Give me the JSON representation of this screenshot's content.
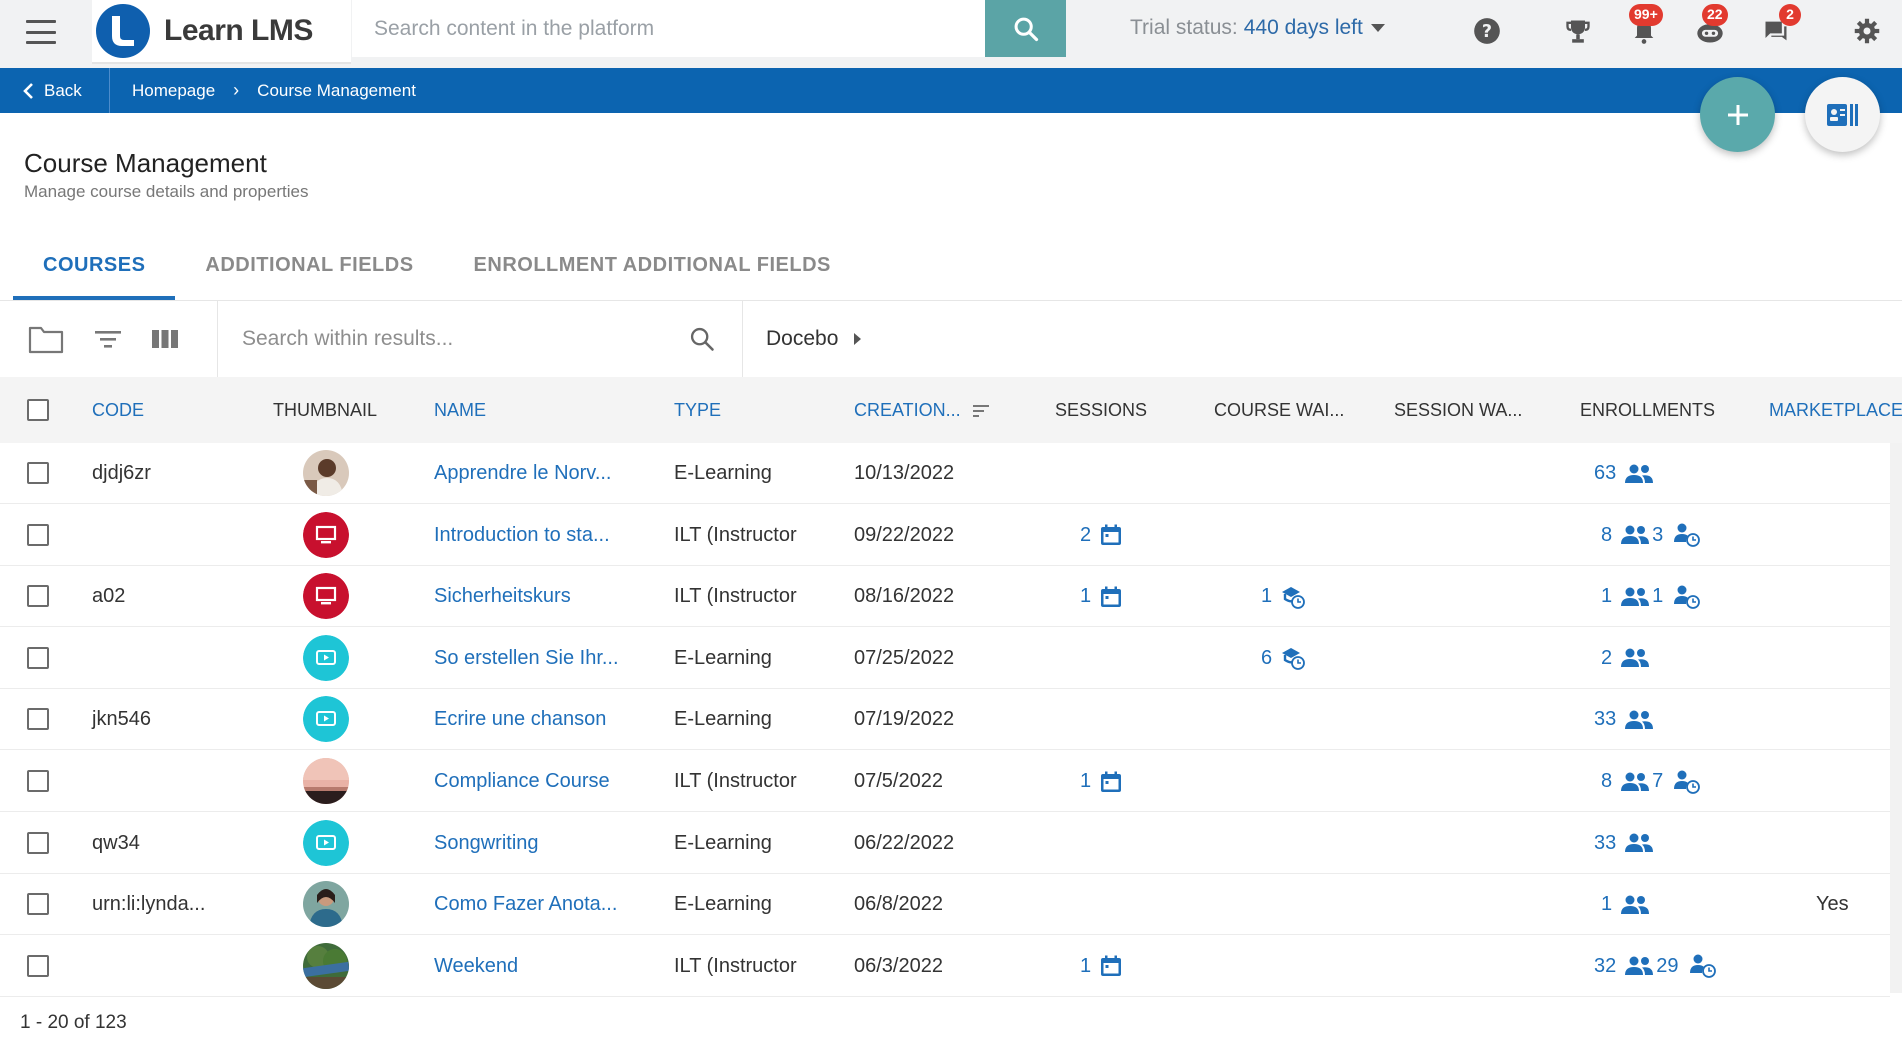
{
  "app": {
    "name": "Learn LMS",
    "search_placeholder": "Search content in the platform",
    "trial_label": "Trial status:",
    "trial_days": "440 days left",
    "badges": {
      "notifications": "99+",
      "robot": "22",
      "chat": "2"
    }
  },
  "breadcrumb": {
    "back_label": "Back",
    "items": [
      "Homepage",
      "Course Management"
    ],
    "separator": "›"
  },
  "page": {
    "title": "Course Management",
    "subtitle": "Manage course details and properties"
  },
  "tabs": [
    {
      "label": "COURSES",
      "active": true
    },
    {
      "label": "ADDITIONAL FIELDS",
      "active": false
    },
    {
      "label": "ENROLLMENT ADDITIONAL FIELDS",
      "active": false
    }
  ],
  "toolbar": {
    "search_placeholder": "Search within results...",
    "branch": "Docebo"
  },
  "table": {
    "columns": {
      "code": "CODE",
      "thumbnail": "THUMBNAIL",
      "name": "NAME",
      "type": "TYPE",
      "creation": "CREATION...",
      "sessions": "SESSIONS",
      "course_waiting": "COURSE WAI...",
      "session_waiting": "SESSION WA...",
      "enrollments": "ENROLLMENTS",
      "marketplace": "MARKETPLACE"
    },
    "rows": [
      {
        "code": "djdj6zr",
        "thumb": "photo-woman",
        "name": "Apprendre le Norv...",
        "type": "E-Learning",
        "creation": "10/13/2022",
        "sessions": "",
        "course_wait": "",
        "session_wait": "",
        "enroll": "63",
        "waitlist": "",
        "marketplace": ""
      },
      {
        "code": "",
        "thumb": "ilt-icon",
        "name": "Introduction to sta...",
        "type": "ILT (Instructor",
        "creation": "09/22/2022",
        "sessions": "2",
        "course_wait": "",
        "session_wait": "",
        "enroll": "8",
        "waitlist": "3",
        "marketplace": ""
      },
      {
        "code": "a02",
        "thumb": "ilt-icon",
        "name": "Sicherheitskurs",
        "type": "ILT (Instructor",
        "creation": "08/16/2022",
        "sessions": "1",
        "course_wait": "1",
        "session_wait": "",
        "enroll": "1",
        "waitlist": "1",
        "marketplace": ""
      },
      {
        "code": "",
        "thumb": "elearning-icon",
        "name": "So erstellen Sie Ihr...",
        "type": "E-Learning",
        "creation": "07/25/2022",
        "sessions": "",
        "course_wait": "6",
        "session_wait": "",
        "enroll": "2",
        "waitlist": "",
        "marketplace": ""
      },
      {
        "code": "jkn546",
        "thumb": "elearning-icon",
        "name": "Ecrire une chanson",
        "type": "E-Learning",
        "creation": "07/19/2022",
        "sessions": "",
        "course_wait": "",
        "session_wait": "",
        "enroll": "33",
        "waitlist": "",
        "marketplace": ""
      },
      {
        "code": "",
        "thumb": "photo-sunset",
        "name": "Compliance Course",
        "type": "ILT (Instructor",
        "creation": "07/5/2022",
        "sessions": "1",
        "course_wait": "",
        "session_wait": "",
        "enroll": "8",
        "waitlist": "7",
        "marketplace": ""
      },
      {
        "code": "qw34",
        "thumb": "elearning-icon",
        "name": "Songwriting",
        "type": "E-Learning",
        "creation": "06/22/2022",
        "sessions": "",
        "course_wait": "",
        "session_wait": "",
        "enroll": "33",
        "waitlist": "",
        "marketplace": ""
      },
      {
        "code": "urn:li:lynda...",
        "thumb": "photo-person",
        "name": "Como Fazer Anota...",
        "type": "E-Learning",
        "creation": "06/8/2022",
        "sessions": "",
        "course_wait": "",
        "session_wait": "",
        "enroll": "1",
        "waitlist": "",
        "marketplace": "Yes"
      },
      {
        "code": "",
        "thumb": "photo-tree",
        "name": "Weekend",
        "type": "ILT (Instructor",
        "creation": "06/3/2022",
        "sessions": "1",
        "course_wait": "",
        "session_wait": "",
        "enroll": "32",
        "waitlist": "29",
        "marketplace": ""
      }
    ]
  },
  "pagination": {
    "range": "1 - 20 of 123"
  },
  "colors": {
    "brand_blue": "#0c64b0",
    "link_blue": "#1f6fba",
    "teal": "#5ba4a6",
    "ilt_red": "#c8102e",
    "elearning_cyan": "#1ec5d6",
    "badge_red": "#e23a2f"
  }
}
